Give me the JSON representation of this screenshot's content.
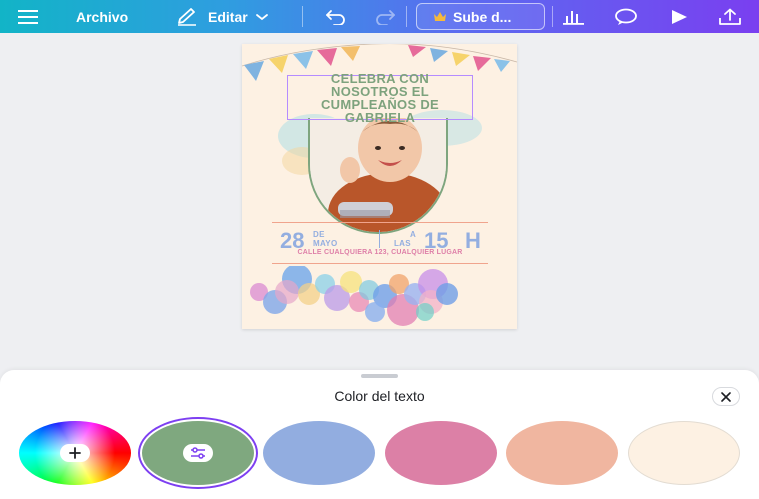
{
  "toolbar": {
    "menu_icon": "hamburger-menu-icon",
    "file_label": "Archivo",
    "edit_label": "Editar",
    "upgrade_label": "Sube d...",
    "colors": {
      "start": "#12b4c7",
      "end": "#7a3ff0"
    }
  },
  "design": {
    "title_lines": [
      "CELEBRA CON",
      "NOSOTROS EL",
      "CUMPLEAÑOS DE",
      "GABRIELA"
    ],
    "date_day": "28",
    "date_de": "DE",
    "date_month": "MAYO",
    "time_a": "A",
    "time_las": "LAS",
    "time_hour": "15",
    "time_h": "H",
    "address": "CALLE CUALQUIERA 123, CUALQUIER LUGAR",
    "background_color": "#fdf1e3",
    "title_color": "#7da27d",
    "date_color": "#93aee0",
    "address_color": "#de7fa8"
  },
  "panel": {
    "title": "Color del texto",
    "swatches": [
      {
        "name": "custom-color",
        "color": "rainbow",
        "icon": "plus-icon"
      },
      {
        "name": "sage-green",
        "color": "#7fa87f",
        "icon": "adjust-sliders-icon",
        "selected": true
      },
      {
        "name": "periwinkle-blue",
        "color": "#92ade0"
      },
      {
        "name": "rose-pink",
        "color": "#dc80a6"
      },
      {
        "name": "peach",
        "color": "#f0b6a0"
      },
      {
        "name": "cream",
        "color": "#fdf1e3"
      }
    ]
  }
}
